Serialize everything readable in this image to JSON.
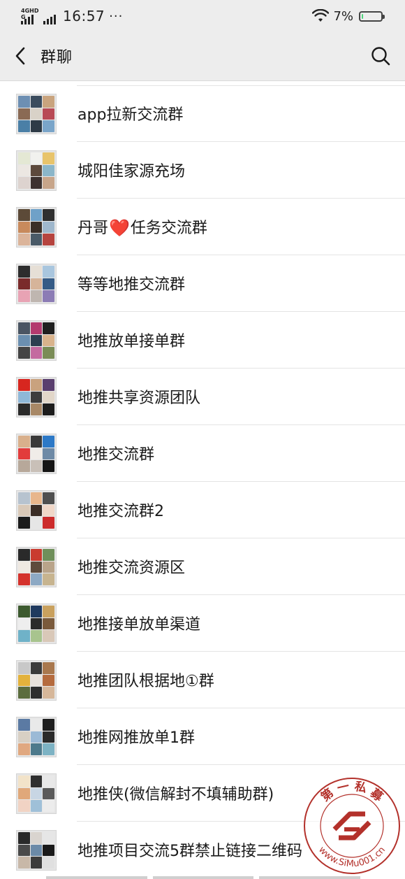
{
  "status_bar": {
    "network_label": "4GHD G",
    "time": "16:57",
    "more": "···",
    "battery_percent": "7%",
    "battery_level": 0.07
  },
  "navbar": {
    "back_icon": "chevron-left-icon",
    "title": "群聊",
    "search_icon": "search-icon"
  },
  "groups": [
    {
      "name": "app拉新交流群"
    },
    {
      "name": "城阳佳家源充场"
    },
    {
      "name_before": "丹哥",
      "emoji": "heart-emoji",
      "emoji_char": "❤️",
      "name_after": "任务交流群"
    },
    {
      "name": "等等地推交流群"
    },
    {
      "name": "地推放单接单群"
    },
    {
      "name": "地推共享资源团队"
    },
    {
      "name": "地推交流群"
    },
    {
      "name": "地推交流群2"
    },
    {
      "name": "地推交流资源区"
    },
    {
      "name": "地推接单放单渠道"
    },
    {
      "name": "地推团队根据地①群"
    },
    {
      "name": "地推网推放单1群"
    },
    {
      "name": "地推侠(微信解封不填辅助群)"
    },
    {
      "name": "地推项目交流5群禁止链接二维码"
    }
  ],
  "watermark": {
    "top_text": "第 一 私 募",
    "bottom_text": "www.SiMu001.cn",
    "color": "#b3312b"
  },
  "colors": {
    "header_bg": "#ededed",
    "separator": "#e4e4e4",
    "heart": "#e5212e"
  }
}
